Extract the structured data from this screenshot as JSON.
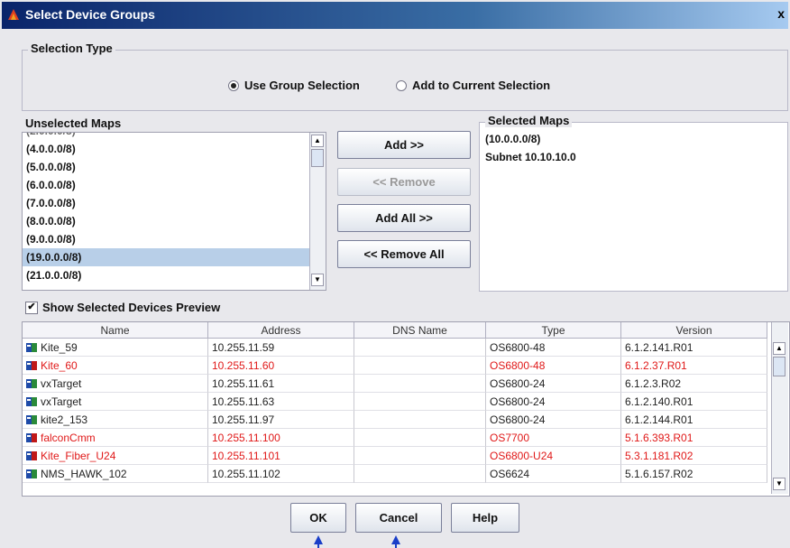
{
  "window": {
    "title": "Select Device Groups",
    "close_glyph": "x"
  },
  "selection_type": {
    "label": "Selection Type",
    "options": [
      {
        "label": "Use Group Selection",
        "selected": true
      },
      {
        "label": "Add to Current Selection",
        "selected": false
      }
    ]
  },
  "unselected_maps": {
    "label": "Unselected Maps",
    "items": [
      "(4.0.0.0/8)",
      "(5.0.0.0/8)",
      "(6.0.0.0/8)",
      "(7.0.0.0/8)",
      "(8.0.0.0/8)",
      "(9.0.0.0/8)",
      "(19.0.0.0/8)",
      "(21.0.0.0/8)"
    ],
    "selected_item": "(19.0.0.0/8)"
  },
  "selected_maps": {
    "label": "Selected Maps",
    "items": [
      "(10.0.0.0/8)",
      "Subnet 10.10.10.0"
    ]
  },
  "transfer_buttons": {
    "add": "Add >>",
    "remove": "<< Remove",
    "add_all": "Add All >>",
    "remove_all": "<< Remove All"
  },
  "preview_checkbox": {
    "label": "Show Selected Devices Preview",
    "checked": true,
    "glyph": "✔"
  },
  "device_table": {
    "columns": [
      "Name",
      "Address",
      "DNS Name",
      "Type",
      "Version"
    ],
    "rows": [
      {
        "name": "Kite_59",
        "address": "10.255.11.59",
        "dns": "",
        "type": "OS6800-48",
        "version": "6.1.2.141.R01",
        "status": "normal"
      },
      {
        "name": "Kite_60",
        "address": "10.255.11.60",
        "dns": "",
        "type": "OS6800-48",
        "version": "6.1.2.37.R01",
        "status": "error"
      },
      {
        "name": "vxTarget",
        "address": "10.255.11.61",
        "dns": "",
        "type": "OS6800-24",
        "version": "6.1.2.3.R02",
        "status": "normal"
      },
      {
        "name": "vxTarget",
        "address": "10.255.11.63",
        "dns": "",
        "type": "OS6800-24",
        "version": "6.1.2.140.R01",
        "status": "normal"
      },
      {
        "name": "kite2_153",
        "address": "10.255.11.97",
        "dns": "",
        "type": "OS6800-24",
        "version": "6.1.2.144.R01",
        "status": "normal"
      },
      {
        "name": "falconCmm",
        "address": "10.255.11.100",
        "dns": "",
        "type": "OS7700",
        "version": "5.1.6.393.R01",
        "status": "error"
      },
      {
        "name": "Kite_Fiber_U24",
        "address": "10.255.11.101",
        "dns": "",
        "type": "OS6800-U24",
        "version": "5.3.1.181.R02",
        "status": "error"
      },
      {
        "name": "NMS_HAWK_102",
        "address": "10.255.11.102",
        "dns": "",
        "type": "OS6624",
        "version": "5.1.6.157.R02",
        "status": "normal"
      }
    ]
  },
  "footer_buttons": {
    "ok": "OK",
    "cancel": "Cancel",
    "help": "Help"
  },
  "colors": {
    "title_bar": "#0a246a",
    "error_text": "#e01818",
    "selection": "#b8cfe8",
    "arrow": "#1a3ec8"
  }
}
